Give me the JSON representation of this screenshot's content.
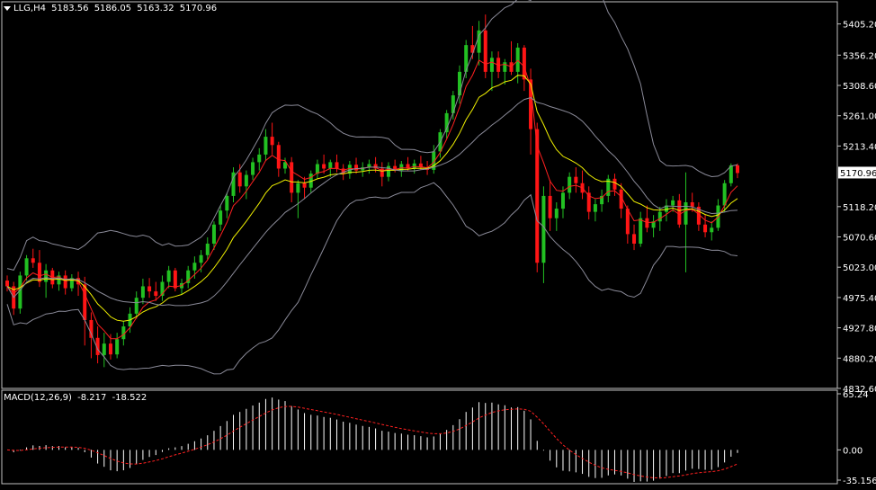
{
  "header": {
    "symbol": "LLG,H4",
    "open": "5183.56",
    "high": "5186.05",
    "low": "5163.32",
    "close": "5170.96"
  },
  "price_axis": {
    "labels": [
      "5405.20",
      "5356.20",
      "5308.60",
      "5261.00",
      "5213.40",
      "5118.20",
      "5070.60",
      "5023.00",
      "4975.40",
      "4927.80",
      "4880.20",
      "4832.60"
    ],
    "current_price": "5170.96"
  },
  "macd": {
    "label": "MACD(12,26,9)",
    "main": "-8.217",
    "signal": "-18.522",
    "axis_labels": [
      "65.24",
      "0.00",
      "-35.156"
    ]
  },
  "colors": {
    "background": "#000000",
    "bull": "#22c022",
    "bear": "#ff1515",
    "ma_red": "#ff2020",
    "ma_yellow": "#f0f000",
    "bands": "#8a8a98",
    "macd_hist": "#ffffff",
    "macd_signal": "#ff2020",
    "grid_frame": "#c0c0c0"
  },
  "chart_data": {
    "type": "candlestick",
    "timeframe": "H4",
    "ylim": [
      4832.6,
      5440
    ],
    "candles": [
      [
        5002,
        5010,
        4985,
        4993
      ],
      [
        4993,
        5000,
        4948,
        4958
      ],
      [
        4958,
        5016,
        4950,
        5010
      ],
      [
        5010,
        5042,
        5002,
        5037
      ],
      [
        5037,
        5052,
        5022,
        5030
      ],
      [
        5030,
        5050,
        4992,
        5000
      ],
      [
        5000,
        5028,
        4975,
        5018
      ],
      [
        5018,
        5022,
        4990,
        4996
      ],
      [
        4996,
        5016,
        4986,
        5010
      ],
      [
        5010,
        5018,
        4980,
        4990
      ],
      [
        4990,
        5012,
        4985,
        5006
      ],
      [
        5006,
        5016,
        4978,
        4996
      ],
      [
        4996,
        5008,
        4900,
        4940
      ],
      [
        4940,
        4952,
        4880,
        4912
      ],
      [
        4912,
        4930,
        4872,
        4885
      ],
      [
        4885,
        4920,
        4866,
        4903
      ],
      [
        4903,
        4918,
        4878,
        4886
      ],
      [
        4886,
        4920,
        4880,
        4910
      ],
      [
        4910,
        4938,
        4900,
        4930
      ],
      [
        4930,
        4960,
        4920,
        4950
      ],
      [
        4950,
        4985,
        4942,
        4975
      ],
      [
        4975,
        5005,
        4965,
        4993
      ],
      [
        4993,
        5006,
        4975,
        4985
      ],
      [
        4985,
        5000,
        4970,
        4978
      ],
      [
        4978,
        5010,
        4970,
        5000
      ],
      [
        5000,
        5025,
        4990,
        5018
      ],
      [
        5018,
        5022,
        4985,
        4990
      ],
      [
        4990,
        5005,
        4980,
        4998
      ],
      [
        4998,
        5025,
        4990,
        5018
      ],
      [
        5018,
        5040,
        5005,
        5030
      ],
      [
        5030,
        5050,
        5015,
        5042
      ],
      [
        5042,
        5070,
        5035,
        5060
      ],
      [
        5060,
        5095,
        5050,
        5090
      ],
      [
        5090,
        5120,
        5080,
        5112
      ],
      [
        5112,
        5140,
        5100,
        5135
      ],
      [
        5135,
        5180,
        5125,
        5172
      ],
      [
        5172,
        5185,
        5140,
        5150
      ],
      [
        5150,
        5175,
        5130,
        5168
      ],
      [
        5168,
        5195,
        5160,
        5188
      ],
      [
        5188,
        5210,
        5175,
        5200
      ],
      [
        5200,
        5240,
        5190,
        5228
      ],
      [
        5228,
        5250,
        5200,
        5215
      ],
      [
        5215,
        5220,
        5165,
        5178
      ],
      [
        5178,
        5195,
        5170,
        5188
      ],
      [
        5188,
        5196,
        5125,
        5140
      ],
      [
        5140,
        5160,
        5100,
        5155
      ],
      [
        5155,
        5165,
        5130,
        5148
      ],
      [
        5148,
        5175,
        5140,
        5170
      ],
      [
        5170,
        5192,
        5162,
        5185
      ],
      [
        5185,
        5200,
        5170,
        5178
      ],
      [
        5178,
        5192,
        5165,
        5188
      ],
      [
        5188,
        5200,
        5172,
        5178
      ],
      [
        5178,
        5185,
        5160,
        5170
      ],
      [
        5170,
        5190,
        5162,
        5184
      ],
      [
        5184,
        5195,
        5170,
        5175
      ],
      [
        5175,
        5188,
        5165,
        5180
      ],
      [
        5180,
        5192,
        5170,
        5185
      ],
      [
        5185,
        5196,
        5172,
        5178
      ],
      [
        5178,
        5188,
        5150,
        5165
      ],
      [
        5165,
        5188,
        5158,
        5182
      ],
      [
        5182,
        5192,
        5172,
        5175
      ],
      [
        5175,
        5190,
        5165,
        5185
      ],
      [
        5185,
        5196,
        5175,
        5178
      ],
      [
        5178,
        5192,
        5170,
        5186
      ],
      [
        5186,
        5198,
        5176,
        5180
      ],
      [
        5180,
        5190,
        5168,
        5176
      ],
      [
        5176,
        5215,
        5170,
        5205
      ],
      [
        5205,
        5240,
        5195,
        5235
      ],
      [
        5235,
        5270,
        5225,
        5265
      ],
      [
        5265,
        5300,
        5255,
        5293
      ],
      [
        5293,
        5340,
        5280,
        5330
      ],
      [
        5330,
        5380,
        5320,
        5372
      ],
      [
        5372,
        5402,
        5350,
        5360
      ],
      [
        5360,
        5410,
        5340,
        5395
      ],
      [
        5395,
        5420,
        5320,
        5330
      ],
      [
        5330,
        5362,
        5300,
        5352
      ],
      [
        5352,
        5362,
        5320,
        5330
      ],
      [
        5330,
        5350,
        5310,
        5345
      ],
      [
        5345,
        5378,
        5325,
        5330
      ],
      [
        5330,
        5375,
        5312,
        5368
      ],
      [
        5368,
        5372,
        5300,
        5318
      ],
      [
        5318,
        5335,
        5200,
        5240
      ],
      [
        5240,
        5250,
        5015,
        5030
      ],
      [
        5030,
        5150,
        4998,
        5135
      ],
      [
        5135,
        5160,
        5080,
        5100
      ],
      [
        5100,
        5125,
        5080,
        5115
      ],
      [
        5115,
        5150,
        5100,
        5140
      ],
      [
        5140,
        5172,
        5130,
        5165
      ],
      [
        5165,
        5180,
        5140,
        5155
      ],
      [
        5155,
        5175,
        5130,
        5140
      ],
      [
        5140,
        5150,
        5098,
        5110
      ],
      [
        5110,
        5130,
        5095,
        5122
      ],
      [
        5122,
        5145,
        5110,
        5135
      ],
      [
        5135,
        5168,
        5125,
        5162
      ],
      [
        5162,
        5170,
        5135,
        5145
      ],
      [
        5145,
        5155,
        5100,
        5115
      ],
      [
        5115,
        5120,
        5060,
        5075
      ],
      [
        5075,
        5090,
        5050,
        5060
      ],
      [
        5060,
        5110,
        5055,
        5100
      ],
      [
        5100,
        5120,
        5078,
        5085
      ],
      [
        5085,
        5105,
        5070,
        5095
      ],
      [
        5095,
        5118,
        5080,
        5110
      ],
      [
        5110,
        5130,
        5095,
        5120
      ],
      [
        5120,
        5135,
        5110,
        5128
      ],
      [
        5128,
        5138,
        5085,
        5090
      ],
      [
        5090,
        5172,
        5015,
        5125
      ],
      [
        5125,
        5140,
        5110,
        5118
      ],
      [
        5118,
        5125,
        5080,
        5090
      ],
      [
        5090,
        5105,
        5070,
        5078
      ],
      [
        5078,
        5095,
        5065,
        5085
      ],
      [
        5085,
        5130,
        5080,
        5120
      ],
      [
        5120,
        5160,
        5110,
        5155
      ],
      [
        5155,
        5186,
        5150,
        5183
      ],
      [
        5183,
        5186,
        5163,
        5171
      ]
    ]
  }
}
